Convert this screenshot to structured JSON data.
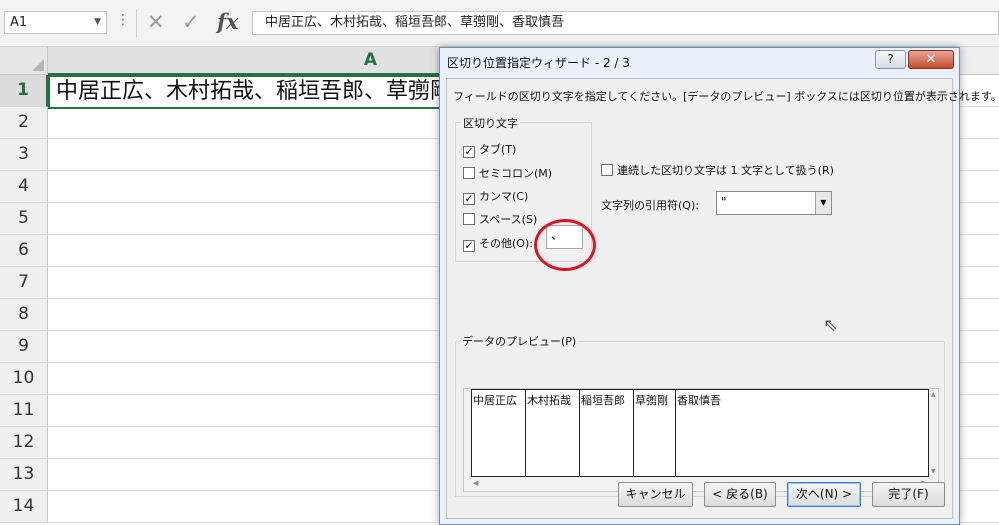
{
  "excel": {
    "name_box": "A1",
    "formula_bar_dots": "⋮",
    "fx_label": "fx",
    "formula": "中居正広、木村拓哉、稲垣吾郎、草彅剛、香取慎吾",
    "column_header": "A",
    "row_numbers": [
      "1",
      "2",
      "3",
      "4",
      "5",
      "6",
      "7",
      "8",
      "9",
      "10",
      "11",
      "12",
      "13",
      "14"
    ],
    "cell_a1": "中居正広、木村拓哉、稲垣吾郎、草彅剛、香取慎吾",
    "accent_color": "#217346"
  },
  "dialog": {
    "title": "区切り位置指定ウィザード - 2 / 3",
    "help_label": "?",
    "close_label": "✕",
    "instruction": "フィールドの区切り文字を指定してください。[データのプレビュー] ボックスには区切り位置が表示されます。",
    "delimiters": {
      "group_label": "区切り文字",
      "tab": {
        "label": "タブ(T)",
        "checked": true
      },
      "semicolon": {
        "label": "セミコロン(M)",
        "checked": false
      },
      "comma": {
        "label": "カンマ(C)",
        "checked": true
      },
      "space": {
        "label": "スペース(S)",
        "checked": false
      },
      "other": {
        "label": "その他(O):",
        "checked": true,
        "value": "、"
      }
    },
    "consecutive": {
      "label": "連続した区切り文字は 1 文字として扱う(R)",
      "checked": false
    },
    "text_qualifier": {
      "label": "文字列の引用符(Q):",
      "value": "\""
    },
    "preview": {
      "label": "データのプレビュー(P)",
      "columns": [
        "中居正広",
        "木村拓哉",
        "稲垣吾郎",
        "草彅剛",
        "香取慎吾"
      ]
    },
    "buttons": {
      "cancel": "キャンセル",
      "back": "< 戻る(B)",
      "next": "次へ(N) >",
      "finish": "完了(F)"
    },
    "highlight_color": "#e0141e"
  }
}
